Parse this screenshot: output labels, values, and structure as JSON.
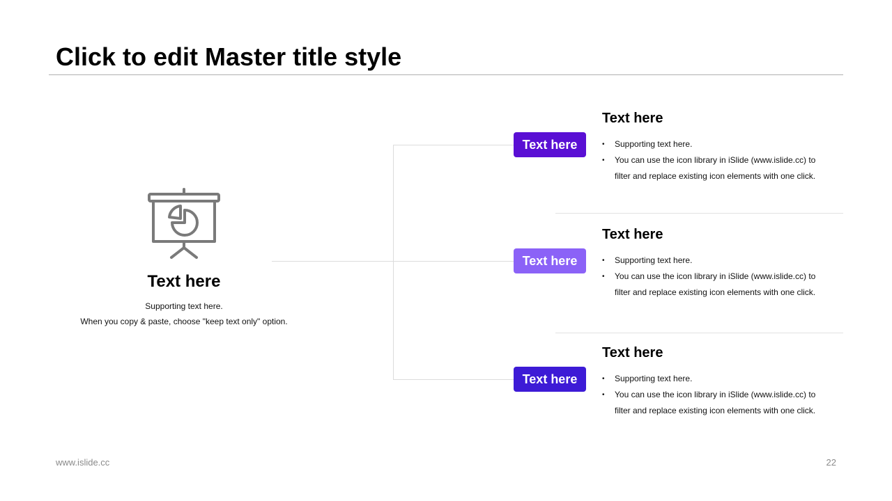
{
  "slide": {
    "title": "Click to edit Master title style",
    "footer_url": "www.islide.cc",
    "page_number": "22"
  },
  "left_panel": {
    "icon": "presentation-board-pie-chart-icon",
    "heading": "Text here",
    "support_lines": [
      "Supporting text here.",
      "When you copy & paste, choose \"keep text only\" option."
    ]
  },
  "items": [
    {
      "tag": "Text here",
      "tag_color": "#5a0fd4",
      "title": "Text here",
      "bullets": [
        "Supporting text here.",
        "You can use the icon library in iSlide  (www.islide.cc) to filter and replace existing icon elements with one click."
      ]
    },
    {
      "tag": "Text here",
      "tag_color": "#8b62f7",
      "title": "Text here",
      "bullets": [
        "Supporting text here.",
        "You can use the icon library in iSlide  (www.islide.cc) to filter and replace existing icon elements with one click."
      ]
    },
    {
      "tag": "Text here",
      "tag_color": "#3d1bd6",
      "title": "Text here",
      "bullets": [
        "Supporting text here.",
        "You can use the icon library in iSlide  (www.islide.cc) to filter and replace existing icon elements with one click."
      ]
    }
  ],
  "colors": {
    "icon_gray": "#7a7a7a",
    "connector_gray": "#dcdcdc"
  }
}
